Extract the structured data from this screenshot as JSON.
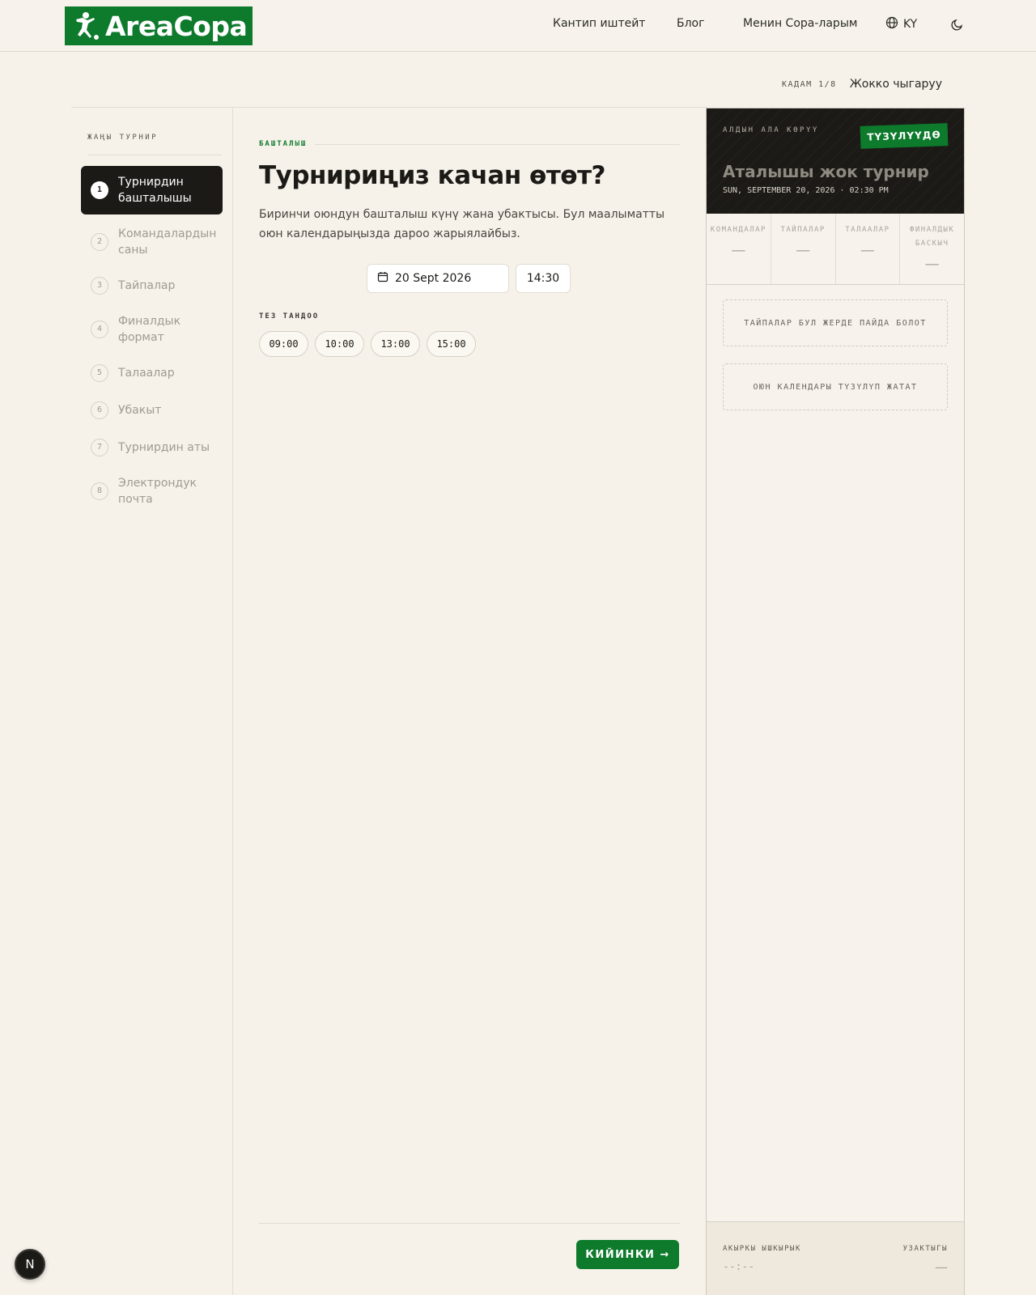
{
  "header": {
    "brand": "AreaCopa",
    "nav": [
      "Кантип иштейт",
      "Блог",
      "Менин Copa-ларым"
    ],
    "language": "KY",
    "icons": {
      "language": "globe-icon",
      "theme": "moon-icon",
      "logo": "footballer-icon"
    }
  },
  "stepper": {
    "count": "КАДАМ 1/8",
    "cancel": "Жокко чыгаруу"
  },
  "sidebar": {
    "title": "ЖАҢЫ ТУРНИР",
    "steps": [
      {
        "num": "1",
        "label": "Турнирдин башталышы"
      },
      {
        "num": "2",
        "label": "Командалардын саны"
      },
      {
        "num": "3",
        "label": "Тайпалар"
      },
      {
        "num": "4",
        "label": "Финалдык формат"
      },
      {
        "num": "5",
        "label": "Талаалар"
      },
      {
        "num": "6",
        "label": "Убакыт"
      },
      {
        "num": "7",
        "label": "Турнирдин аты"
      },
      {
        "num": "8",
        "label": "Электрондук почта"
      }
    ],
    "active_index": 0
  },
  "main": {
    "eyebrow": "БАШТАЛЫШ",
    "title": "Турнириңиз качан өтөт?",
    "description": "Биринчи оюндун башталыш күнү жана убактысы. Бул маалыматты оюн календарыңызда дароо жарыялайбыз.",
    "date_value": "20 Sept 2026",
    "time_value": "14:30",
    "quick_label": "ТЕЗ ТАНДОО",
    "quick_times": [
      "09:00",
      "10:00",
      "13:00",
      "15:00"
    ],
    "next_label": "КИЙИНКИ →"
  },
  "preview": {
    "label": "АЛДЫН АЛА КӨРҮҮ",
    "badge": "ТҮЗҮЛҮҮДӨ",
    "title": "Аталышы жок турнир",
    "date": "SUN, SEPTEMBER 20, 2026 · 02:30 PM",
    "stats": [
      {
        "label": "КОМАНДАЛАР",
        "value": "—"
      },
      {
        "label": "ТАЙПАЛАР",
        "value": "—"
      },
      {
        "label": "ТАЛААЛАР",
        "value": "—"
      },
      {
        "label": "ФИНАЛДЫК БАСКЫЧ",
        "value": "—"
      }
    ],
    "groups_placeholder": "ТАЙПАЛАР БУЛ ЖЕРДЕ ПАЙДА БОЛОТ",
    "schedule_placeholder": "ОЮН КАЛЕНДАРЫ ТҮЗҮЛҮП ЖАТАТ",
    "footer": {
      "last_whistle_label": "АКЫРКЫ ЫШКЫРЫК",
      "last_whistle_value": "--:--",
      "duration_label": "УЗАКТЫГЫ",
      "duration_value": "—"
    }
  },
  "dev_badge": "N",
  "colors": {
    "accent": "#0d7a2c",
    "dark": "#1c1a17",
    "background": "#f6f2ea"
  }
}
